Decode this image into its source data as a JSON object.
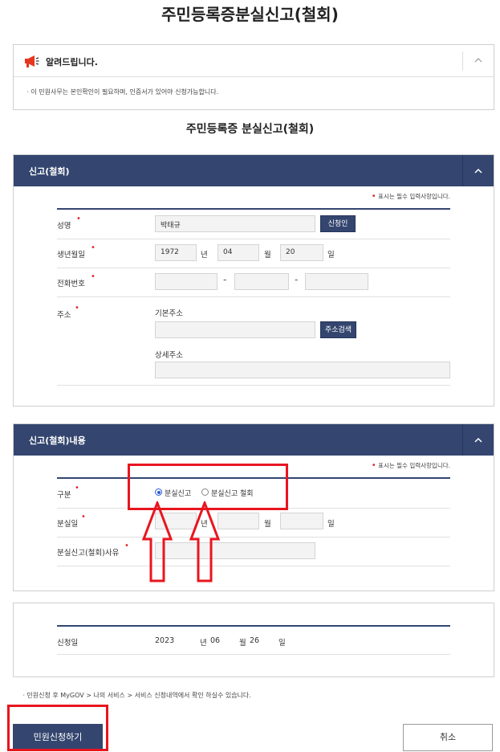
{
  "page": {
    "title": "주민등록증분실신고(철회)"
  },
  "notice": {
    "title": "알려드립니다.",
    "body": "ㆍ이 민원사무는 본인확인이 필요하며, 인증서가 있어야 신청가능합니다."
  },
  "form_title": "주민등록증 분실신고(철회)",
  "required_note": "표시는 필수 입력사항입니다.",
  "panel1": {
    "header": "신고(철회)",
    "name_label": "성명",
    "name_value": "박태규",
    "applicant_button": "신청인",
    "birth_label": "생년월일",
    "birth_year": "1972",
    "birth_year_unit": "년",
    "birth_month": "04",
    "birth_month_unit": "월",
    "birth_day": "20",
    "birth_day_unit": "일",
    "phone_label": "전화번호",
    "phone_sep": "-",
    "address_label": "주소",
    "basic_address_label": "기본주소",
    "address_search_button": "주소검색",
    "detail_address_label": "상세주소"
  },
  "panel2": {
    "header": "신고(철회)내용",
    "type_label": "구분",
    "radio_options": [
      "분실신고",
      "분실신고 철회"
    ],
    "selected_radio": "분실신고",
    "lost_date_label": "분실일",
    "year_unit": "년",
    "month_unit": "월",
    "day_unit": "일",
    "reason_label": "분실신고(철회)사유"
  },
  "apply_date": {
    "label": "신청일",
    "year": "2023",
    "year_unit": "년",
    "month": "06",
    "month_unit": "월",
    "day": "26",
    "day_unit": "일"
  },
  "footer_note": "ㆍ민원신청 후 MyGOV > 나의 서비스 > 서비스 신청내역에서 확인 하실수 있습니다.",
  "buttons": {
    "submit": "민원신청하기",
    "cancel": "취소"
  },
  "colors": {
    "navy": "#34466f",
    "annotation_red": "#e8151f",
    "radio_blue": "#2a5bd7"
  }
}
